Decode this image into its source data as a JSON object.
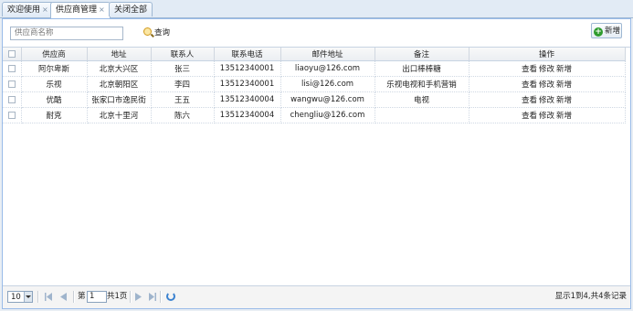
{
  "tabs": [
    {
      "label": "欢迎使用",
      "close": "×"
    },
    {
      "label": "供应商管理",
      "close": "×"
    },
    {
      "label": "关闭全部"
    }
  ],
  "toolbar": {
    "search_placeholder": "供应商名称",
    "search_label": "查询",
    "add_label": "新增"
  },
  "grid": {
    "columns": [
      "供应商",
      "地址",
      "联系人",
      "联系电话",
      "邮件地址",
      "备注",
      "操作"
    ],
    "rows": [
      {
        "name": "阿尔卑斯",
        "address": "北京大兴区",
        "contact": "张三",
        "phone": "13512340001",
        "email": "liaoyu@126.com",
        "note": "出口棒棒糖",
        "ops": [
          "查看",
          "修改",
          "新增"
        ]
      },
      {
        "name": "乐视",
        "address": "北京朝阳区",
        "contact": "李四",
        "phone": "13512340001",
        "email": "lisi@126.com",
        "note": "乐视电视和手机营销",
        "ops": [
          "查看",
          "修改",
          "新增"
        ]
      },
      {
        "name": "优酷",
        "address": "张家口市逸民街",
        "contact": "王五",
        "phone": "13512340004",
        "email": "wangwu@126.com",
        "note": "电视",
        "ops": [
          "查看",
          "修改",
          "新增"
        ]
      },
      {
        "name": "耐克",
        "address": "北京十里河",
        "contact": "陈六",
        "phone": "13512340004",
        "email": "chengliu@126.com",
        "note": "",
        "ops": [
          "查看",
          "修改",
          "新增"
        ]
      }
    ]
  },
  "pager": {
    "page_size": "10",
    "page_prefix": "第",
    "page_value": "1",
    "page_total": "共1页",
    "summary": "显示1到4,共4条记录"
  },
  "colors": {
    "border": "#99bbe8",
    "add_icon": "#2e9c2e",
    "refresh_icon": "#3b82d0"
  }
}
